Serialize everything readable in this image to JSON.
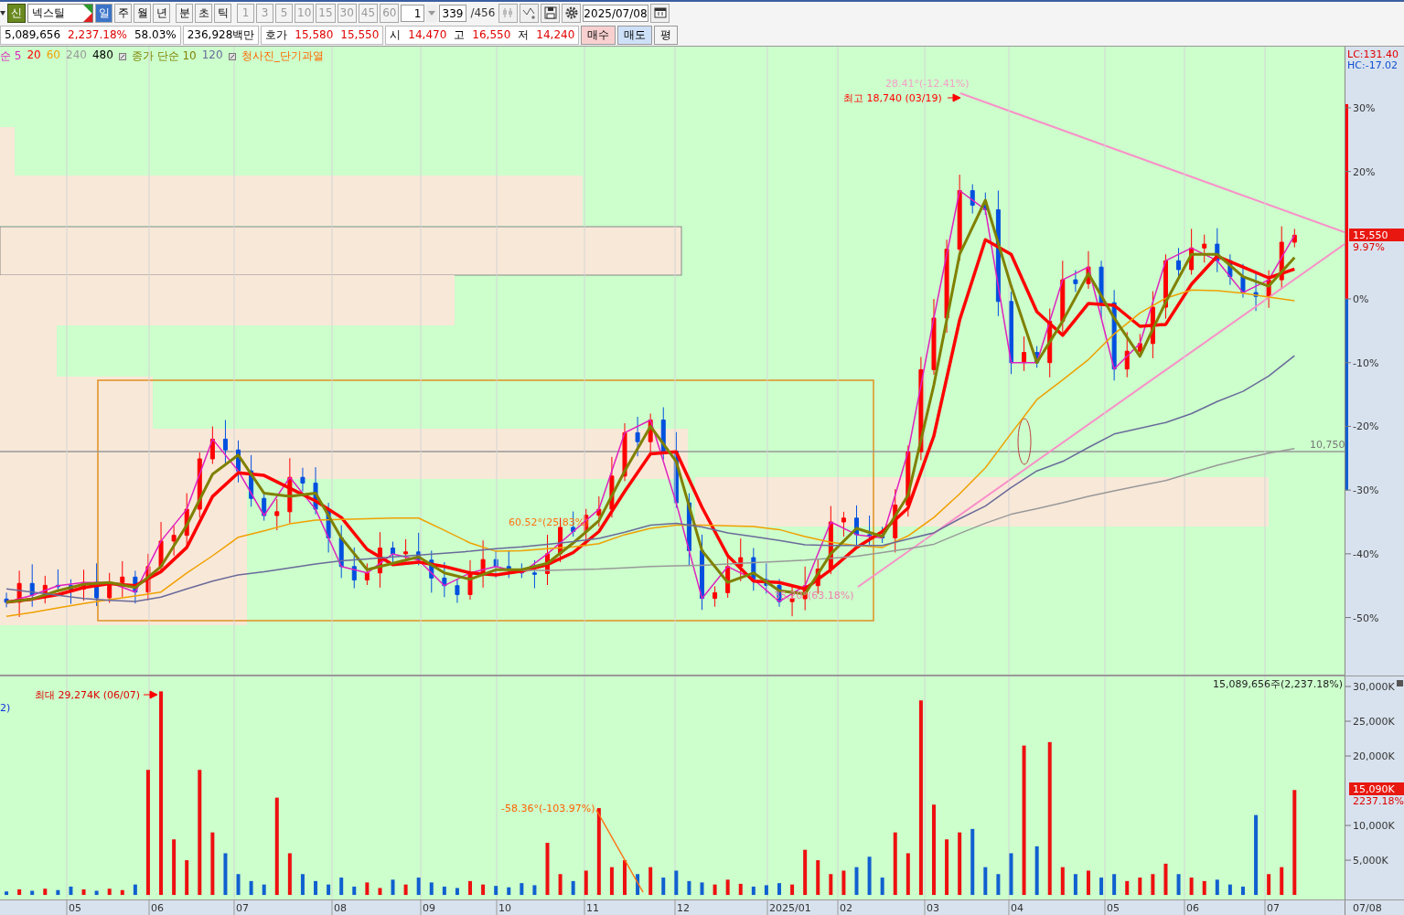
{
  "toolbar": {
    "market_badge": "신",
    "stock": "넥스틸",
    "periods": [
      {
        "label": "일",
        "selected": true
      },
      {
        "label": "주",
        "selected": false
      },
      {
        "label": "월",
        "selected": false
      },
      {
        "label": "년",
        "selected": false
      }
    ],
    "units": [
      {
        "label": "분",
        "selected": false
      },
      {
        "label": "초",
        "selected": false
      },
      {
        "label": "틱",
        "selected": false
      }
    ],
    "intervals": [
      {
        "label": "1",
        "disabled": true
      },
      {
        "label": "3",
        "disabled": true
      },
      {
        "label": "5",
        "disabled": true
      },
      {
        "label": "10",
        "disabled": true
      },
      {
        "label": "15",
        "disabled": true
      },
      {
        "label": "30",
        "disabled": true
      },
      {
        "label": "45",
        "disabled": true
      },
      {
        "label": "60",
        "disabled": true
      }
    ],
    "spin": "1",
    "count": "339",
    "total": "/456",
    "date": "2025/07/08"
  },
  "quote": {
    "volume": "5,089,656",
    "volume_ratio": "2,237.18%",
    "turnover": "58.03%",
    "amount": "236,928백만",
    "ask_label": "호가",
    "ask": "15,580",
    "bid": "15,550",
    "fields": [
      {
        "label": "시",
        "value": "14,470"
      },
      {
        "label": "고",
        "value": "16,550"
      },
      {
        "label": "저",
        "value": "14,240"
      }
    ],
    "buttons": [
      {
        "label": "매수",
        "kind": "buy"
      },
      {
        "label": "매도",
        "kind": "sell"
      },
      {
        "label": "평",
        "kind": "plain"
      }
    ]
  },
  "price_chart": {
    "lc": "LC:131.40",
    "hc": "HC:-17.02",
    "last_price": "15,550",
    "last_change": "9.97%",
    "inactive_legend": "480",
    "signal_legend": "청사진_단기과열",
    "level_label": "10,750",
    "annotations": [
      "최고 18,740 (03/19)",
      "28.41°(-12.41%)",
      "60.52°(25.83%)",
      "35.20°(63.18%)"
    ],
    "chart_data": {
      "type": "line",
      "grid": true,
      "ylim": [
        -59.1,
        39.6
      ],
      "yticks": [
        {
          "value": 30,
          "label": "30%"
        },
        {
          "value": 20,
          "label": "20%"
        },
        {
          "value": 0,
          "label": "0%"
        },
        {
          "value": -10,
          "label": "-10%"
        },
        {
          "value": -20,
          "label": "-20%"
        },
        {
          "value": -30,
          "label": "-30%"
        },
        {
          "value": -40,
          "label": "-40%"
        },
        {
          "value": -50,
          "label": "-50%"
        }
      ],
      "series": [
        {
          "name": "순 5",
          "color": "#e020c0",
          "values": [
            -47.6,
            -46.5,
            -45,
            -44.5,
            -44.5,
            -46,
            -38,
            -33,
            -22,
            -27,
            -34,
            -28,
            -33,
            -42,
            -43,
            -40,
            -41,
            -45,
            -43,
            -42,
            -43,
            -40,
            -36.5,
            -33,
            -21,
            -19,
            -32,
            -47,
            -42,
            -44,
            -47.5,
            -45,
            -35,
            -37,
            -37.5,
            -24,
            -3,
            17,
            14,
            -10,
            -10,
            3,
            5,
            -11,
            -7,
            6,
            8,
            6,
            1,
            3,
            10
          ]
        },
        {
          "name": "20",
          "color": "#ff0000",
          "values": [
            -47.6,
            -47.1,
            -46.4,
            -45.3,
            -44.7,
            -45,
            -42.8,
            -39,
            -31,
            -27.3,
            -27.7,
            -29.7,
            -31.7,
            -34.3,
            -39.3,
            -41.7,
            -41.3,
            -42,
            -43,
            -43.3,
            -42.7,
            -41.7,
            -39.8,
            -36.5,
            -30.2,
            -24.3,
            -24,
            -32.7,
            -40.3,
            -44.3,
            -44.5,
            -45.5,
            -42.5,
            -39,
            -36.5,
            -32.8,
            -21.5,
            -3.3,
            9.3,
            7,
            -2,
            -5.7,
            -0.7,
            -1,
            -4.3,
            -4,
            2.3,
            6.7,
            5,
            3.3,
            4.7
          ]
        },
        {
          "name": "60",
          "color": "#f0a000",
          "values": [
            -49.8,
            -49.2,
            -48.5,
            -47.8,
            -47.2,
            -46.6,
            -46,
            -43,
            -40.3,
            -37.4,
            -36.4,
            -35.3,
            -34.7,
            -34.6,
            -34.5,
            -34.4,
            -34.4,
            -36.3,
            -38.3,
            -39.6,
            -39.5,
            -39.2,
            -38.9,
            -38.4,
            -37,
            -36,
            -35.5,
            -35.5,
            -35.6,
            -35.7,
            -36.2,
            -37.3,
            -38.2,
            -38.7,
            -39,
            -37.2,
            -34.3,
            -30.6,
            -26.5,
            -21.1,
            -15.8,
            -12.7,
            -9.5,
            -5.5,
            -2.2,
            0.1,
            1.4,
            1.3,
            0.9,
            0.3,
            -0.3
          ]
        },
        {
          "name": "240",
          "color": "#999999",
          "values": [
            null,
            null,
            null,
            null,
            null,
            null,
            null,
            null,
            null,
            null,
            null,
            null,
            null,
            null,
            null,
            null,
            null,
            null,
            null,
            null,
            -42.6,
            -42.6,
            -42.5,
            -42.4,
            -42.2,
            -42,
            -41.9,
            -41.8,
            -41.6,
            -41.4,
            -41.2,
            -41,
            -40.7,
            -40.4,
            -39.8,
            -39.2,
            -38.5,
            -36.8,
            -35.2,
            -33.8,
            -32.9,
            -32,
            -31,
            -30.1,
            -29.3,
            -28.5,
            -27.3,
            -26.1,
            -25.1,
            -24.2,
            -23.5
          ]
        },
        {
          "name": "종가 단순 10",
          "color": "#808000",
          "values": [
            -47.6,
            -47.1,
            -45.8,
            -44.8,
            -44.5,
            -45.3,
            -42,
            -35.5,
            -27.5,
            -24.5,
            -30.5,
            -31,
            -30.5,
            -37.5,
            -42.5,
            -41.5,
            -40.5,
            -43,
            -44,
            -42.5,
            -42.5,
            -41.5,
            -38.3,
            -34.8,
            -27,
            -20,
            -25.5,
            -39.5,
            -44.5,
            -43,
            -45.8,
            -46.3,
            -40,
            -36,
            -37.3,
            -30.8,
            -13.5,
            7,
            15.5,
            2,
            -10,
            -3.5,
            4,
            -3,
            -9,
            -0.5,
            7,
            7,
            3.5,
            2,
            6.5
          ]
        },
        {
          "name": "120",
          "color": "#6a6a9a",
          "values": [
            -45.5,
            -46,
            -46.5,
            -47,
            -47.3,
            -47.5,
            -46.8,
            -45.5,
            -44.3,
            -43.3,
            -42.8,
            -42.2,
            -41.6,
            -41.1,
            -40.8,
            -40.5,
            -40.2,
            -39.9,
            -39.6,
            -39.2,
            -38.9,
            -38.5,
            -38.1,
            -37.6,
            -36.6,
            -35.5,
            -35.2,
            -35.8,
            -36.7,
            -37.3,
            -37.9,
            -38.6,
            -38.7,
            -38.7,
            -38.7,
            -37.7,
            -36.7,
            -34.5,
            -32.5,
            -29.6,
            -27,
            -25.5,
            -23.3,
            -21.2,
            -20.3,
            -19.4,
            -18,
            -16.1,
            -14.5,
            -12.1,
            -8.9
          ]
        }
      ]
    }
  },
  "volume_chart": {
    "legend_tail": "2)",
    "max_label": "최대 29,274K (06/07)",
    "total": "15,089,656주(2,237.18%)",
    "last_volume": "15,090K",
    "last_ratio": "2237.18%",
    "angle_label": "-58.36°(-103.97%)",
    "chart_data": {
      "type": "bar",
      "grid": true,
      "ylim": [
        -650,
        31450
      ],
      "yticks": [
        {
          "value": 30000,
          "label": "30,000K"
        },
        {
          "value": 25000,
          "label": "25,000K"
        },
        {
          "value": 20000,
          "label": "20,000K"
        },
        {
          "value": 10000,
          "label": "10,000K"
        },
        {
          "value": 5000,
          "label": "5,000K"
        }
      ],
      "values": [
        500,
        800,
        600,
        900,
        700,
        1200,
        800,
        600,
        900,
        700,
        1500,
        18000,
        29300,
        8000,
        5000,
        18000,
        9000,
        6000,
        3000,
        2000,
        1500,
        14000,
        6000,
        3000,
        2000,
        1500,
        2500,
        1200,
        1800,
        1000,
        2200,
        1500,
        2500,
        1800,
        1200,
        1000,
        2000,
        1500,
        1300,
        1100,
        1700,
        1400,
        7500,
        3000,
        2000,
        3500,
        12500,
        4000,
        5000,
        3000,
        4000,
        2500,
        3500,
        2000,
        1800,
        1500,
        2200,
        1600,
        1200,
        1400,
        1700,
        1500,
        6500,
        5000,
        3000,
        3500,
        4000,
        5500,
        2500,
        9000,
        6000,
        28000,
        13000,
        8000,
        9000,
        9500,
        4000,
        3000,
        6000,
        21500,
        7000,
        22000,
        4000,
        3000,
        3500,
        2500,
        3000,
        2000,
        2500,
        3000,
        4500,
        3000,
        2500,
        2000,
        2200,
        1500,
        1200,
        11500,
        3000,
        4000,
        15100,
        null,
        null,
        null,
        null,
        null,
        null,
        null,
        null
      ]
    }
  },
  "date_axis": {
    "labels": [
      "05",
      "06",
      "07",
      "08",
      "09",
      "10",
      "11",
      "12",
      "2025/01",
      "02",
      "03",
      "04",
      "05",
      "06",
      "07"
    ],
    "end_date": "07/08"
  }
}
